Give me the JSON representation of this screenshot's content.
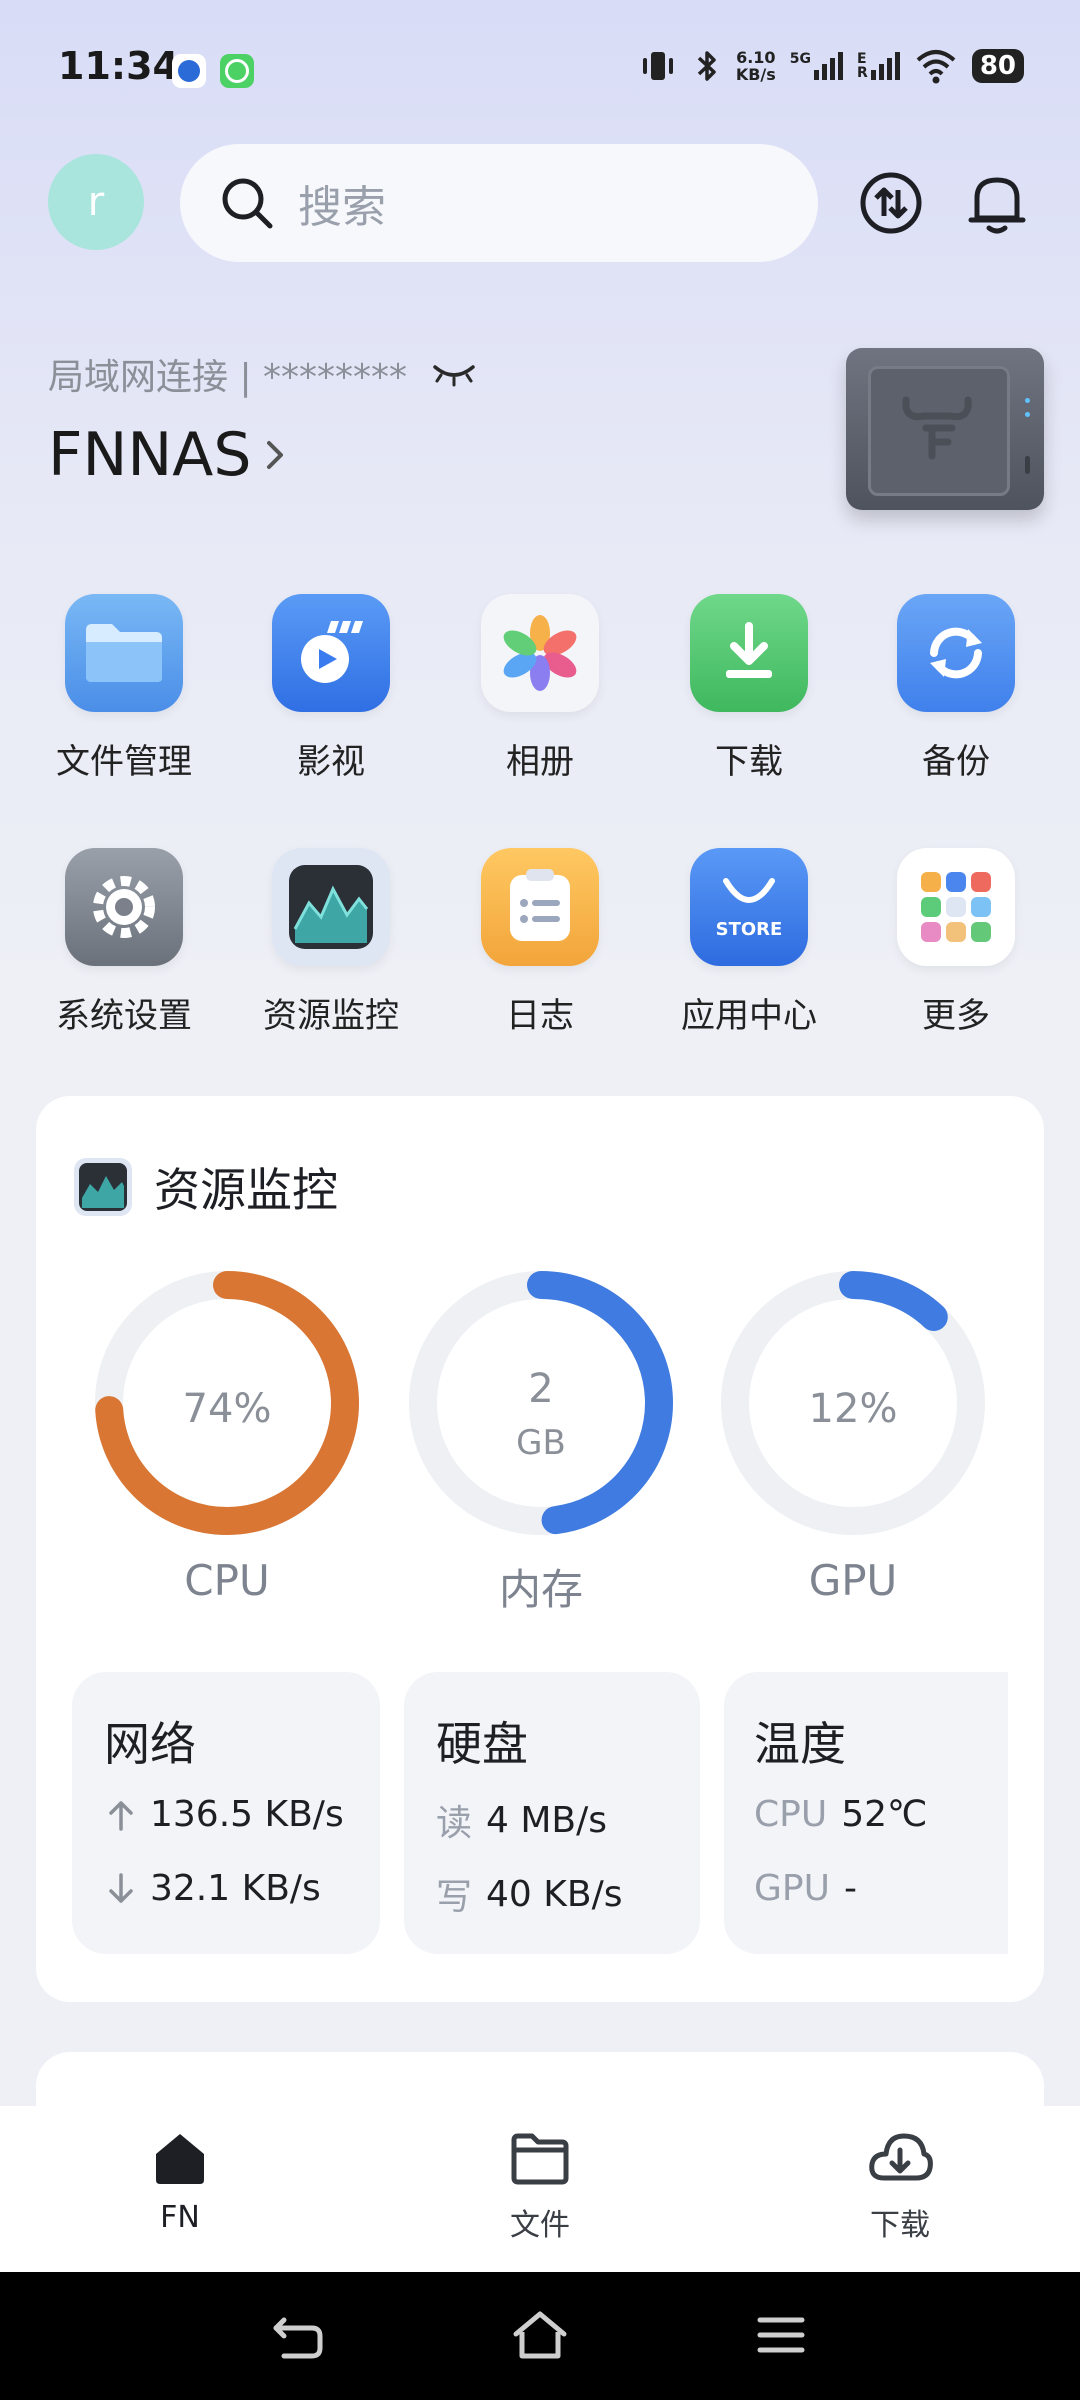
{
  "status": {
    "time": "11:34",
    "net_speed_value": "6.10",
    "net_speed_unit": "KB/s",
    "signal1_label": "5G",
    "signal2_label": "E",
    "signal2_sub": "R",
    "battery": "80"
  },
  "header": {
    "avatar_letter": "r",
    "search_placeholder": "搜索"
  },
  "device": {
    "connection": "局域网连接 | ********",
    "name": "FNNAS"
  },
  "apps": [
    {
      "label": "文件管理",
      "icon": "folder-icon",
      "color": "#5aa2ee"
    },
    {
      "label": "影视",
      "icon": "film-icon",
      "color": "#3a7cf0"
    },
    {
      "label": "相册",
      "icon": "photos-flower-icon",
      "color": "#ffffff"
    },
    {
      "label": "下载",
      "icon": "download-icon",
      "color": "#4cc56a"
    },
    {
      "label": "备份",
      "icon": "backup-sync-icon",
      "color": "#4d8ff2"
    },
    {
      "label": "系统设置",
      "icon": "gear-icon",
      "color": "#7b808a"
    },
    {
      "label": "资源监控",
      "icon": "monitor-chart-icon",
      "color": "#2b2f36"
    },
    {
      "label": "日志",
      "icon": "log-notepad-icon",
      "color": "#f4b44b"
    },
    {
      "label": "应用中心",
      "icon": "store-bag-icon",
      "color": "#3f7ff0",
      "badge": "STORE"
    },
    {
      "label": "更多",
      "icon": "more-grid-icon",
      "color": "#ffffff"
    }
  ],
  "monitor": {
    "title": "资源监控",
    "cpu": {
      "label": "CPU",
      "value_text": "74%",
      "percent": 74,
      "color": "#d97633"
    },
    "memory": {
      "label": "内存",
      "value_line1": "2",
      "value_line2": "GB",
      "percent": 48,
      "color": "#3f7be0"
    },
    "gpu": {
      "label": "GPU",
      "value_text": "12%",
      "percent": 12,
      "color": "#3f7be0"
    },
    "network": {
      "title": "网络",
      "up": "136.5 KB/s",
      "down": "32.1 KB/s"
    },
    "disk": {
      "title": "硬盘",
      "read_key": "读",
      "read": "4 MB/s",
      "write_key": "写",
      "write": "40 KB/s"
    },
    "temperature": {
      "title": "温度",
      "cpu_key": "CPU",
      "cpu": "52℃",
      "gpu_key": "GPU",
      "gpu": "-"
    }
  },
  "tabs": [
    {
      "label": "FN",
      "icon": "home-icon",
      "active": true
    },
    {
      "label": "文件",
      "icon": "folder-outline-icon",
      "active": false
    },
    {
      "label": "下载",
      "icon": "cloud-download-icon",
      "active": false
    }
  ]
}
